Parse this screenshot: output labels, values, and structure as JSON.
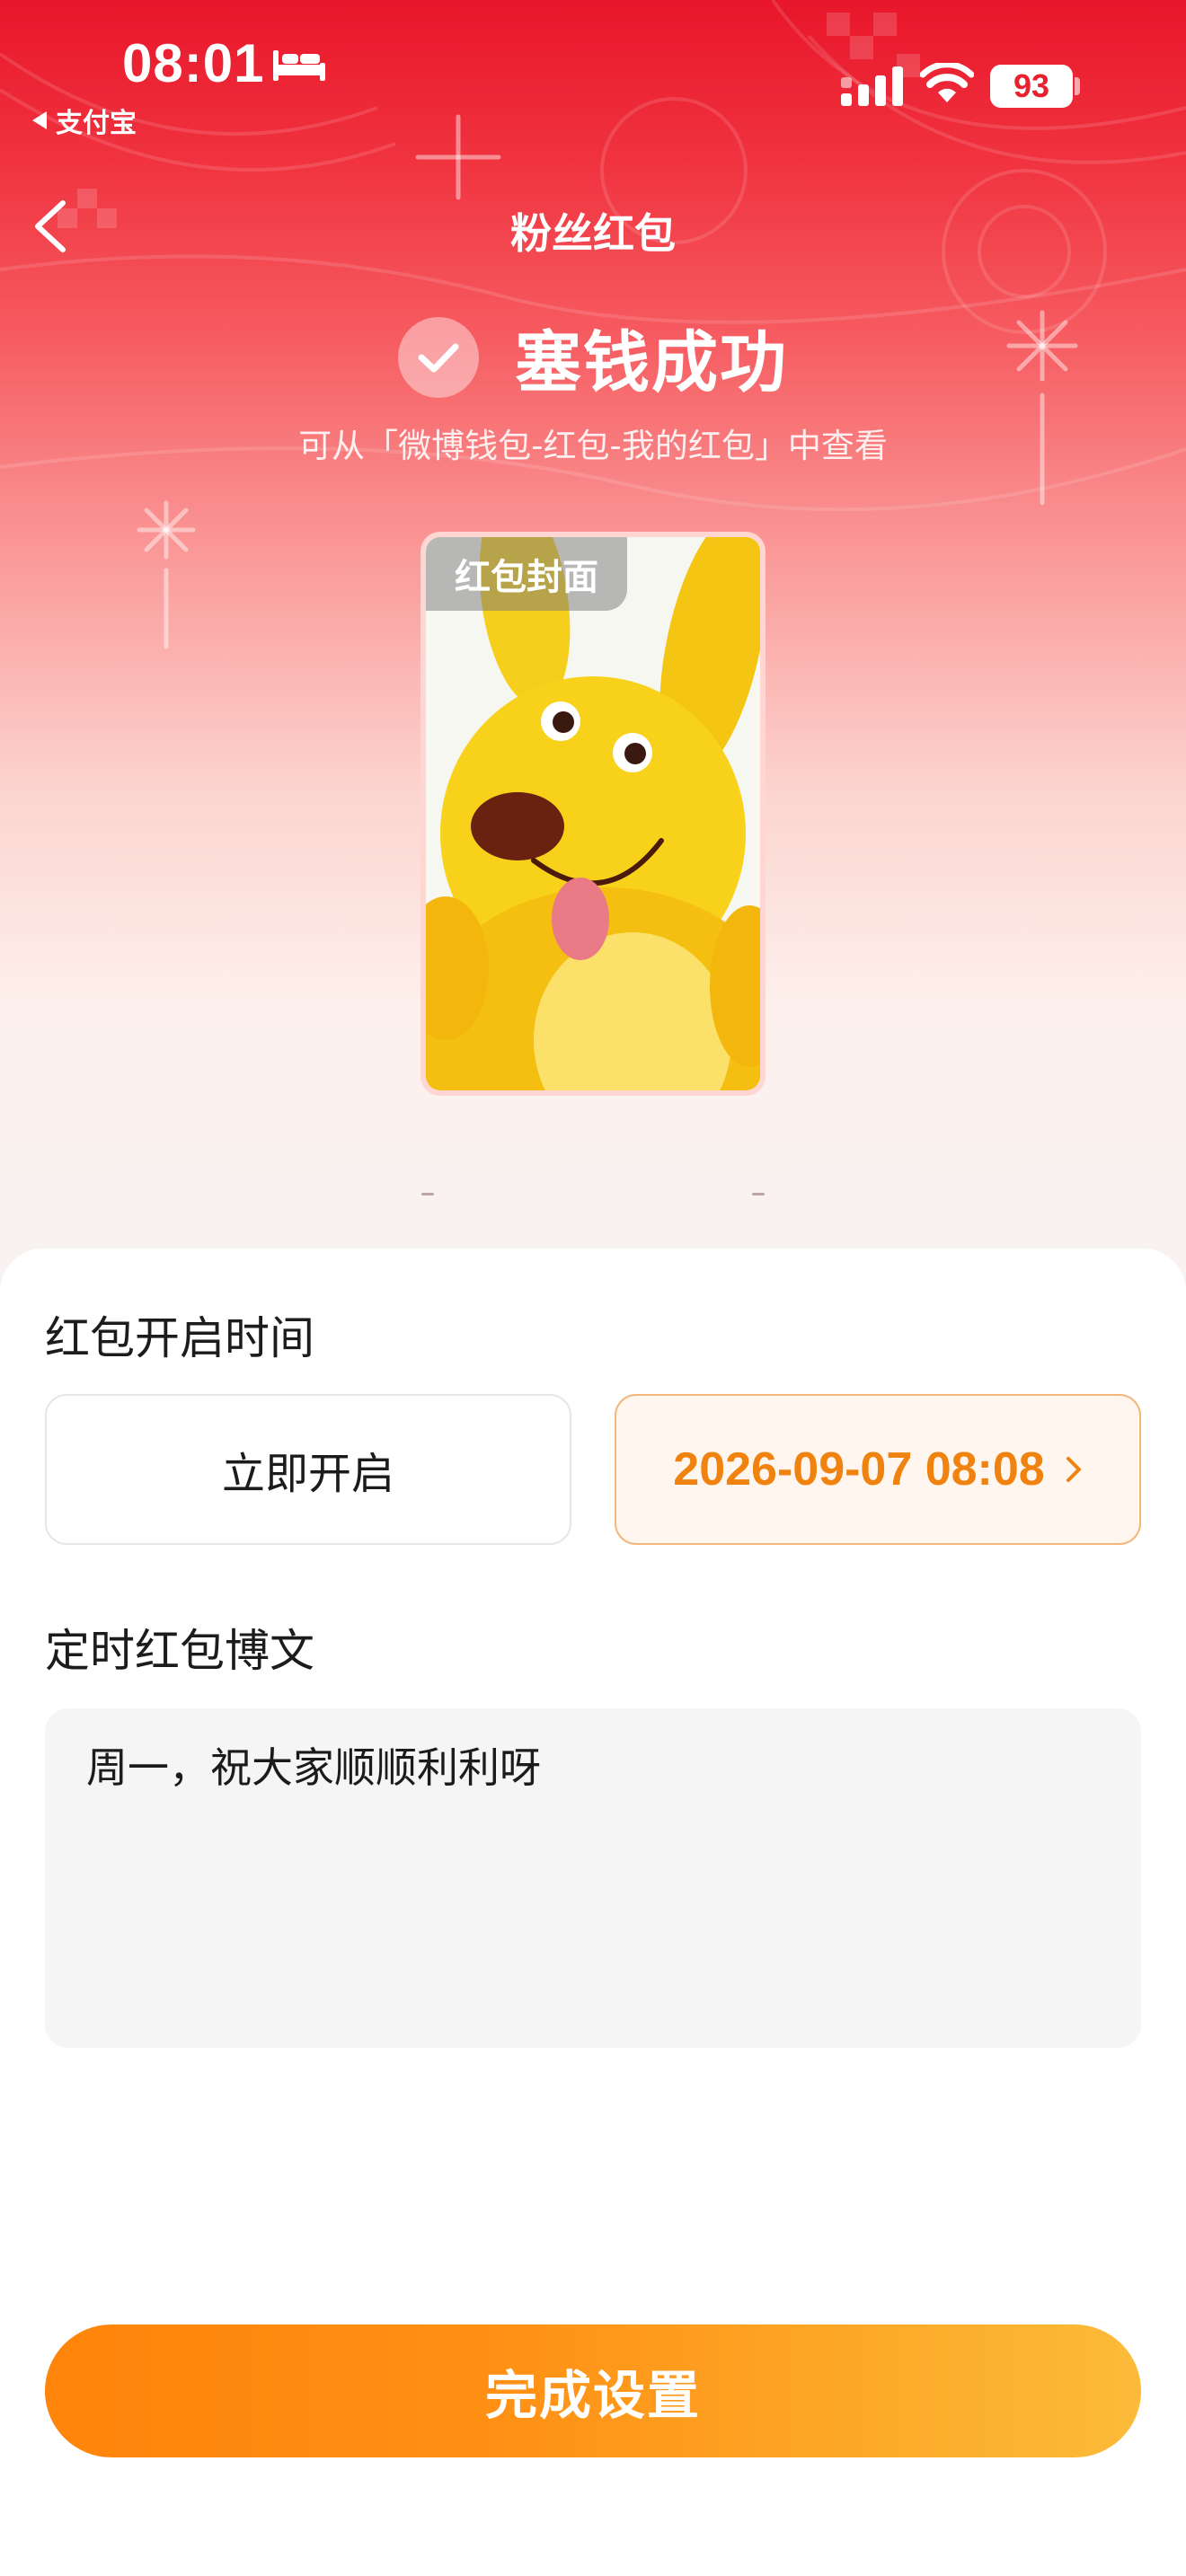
{
  "status_bar": {
    "time": "08:01",
    "back_app_label": "支付宝",
    "battery_level": "93",
    "icons": [
      "bed-icon",
      "signal-icon",
      "wifi-icon",
      "battery-icon"
    ]
  },
  "nav": {
    "title": "粉丝红包",
    "back_icon": "chevron-left-icon"
  },
  "success": {
    "title": "塞钱成功",
    "subtitle": "可从「微博钱包-红包-我的红包」中查看",
    "icon": "check-icon"
  },
  "cover": {
    "badge": "红包封面"
  },
  "open_time": {
    "section_title": "红包开启时间",
    "option_now": "立即开启",
    "option_scheduled": "2026-09-07 08:08",
    "scheduled_selected": true,
    "accent_color": "#f08310"
  },
  "post": {
    "section_title": "定时红包博文",
    "content": "周一，祝大家顺顺利利呀"
  },
  "footer": {
    "done_label": "完成设置"
  },
  "colors": {
    "hero_red": "#e8162a",
    "button_orange_start": "#ff840a",
    "button_orange_end": "#fbbb38"
  }
}
